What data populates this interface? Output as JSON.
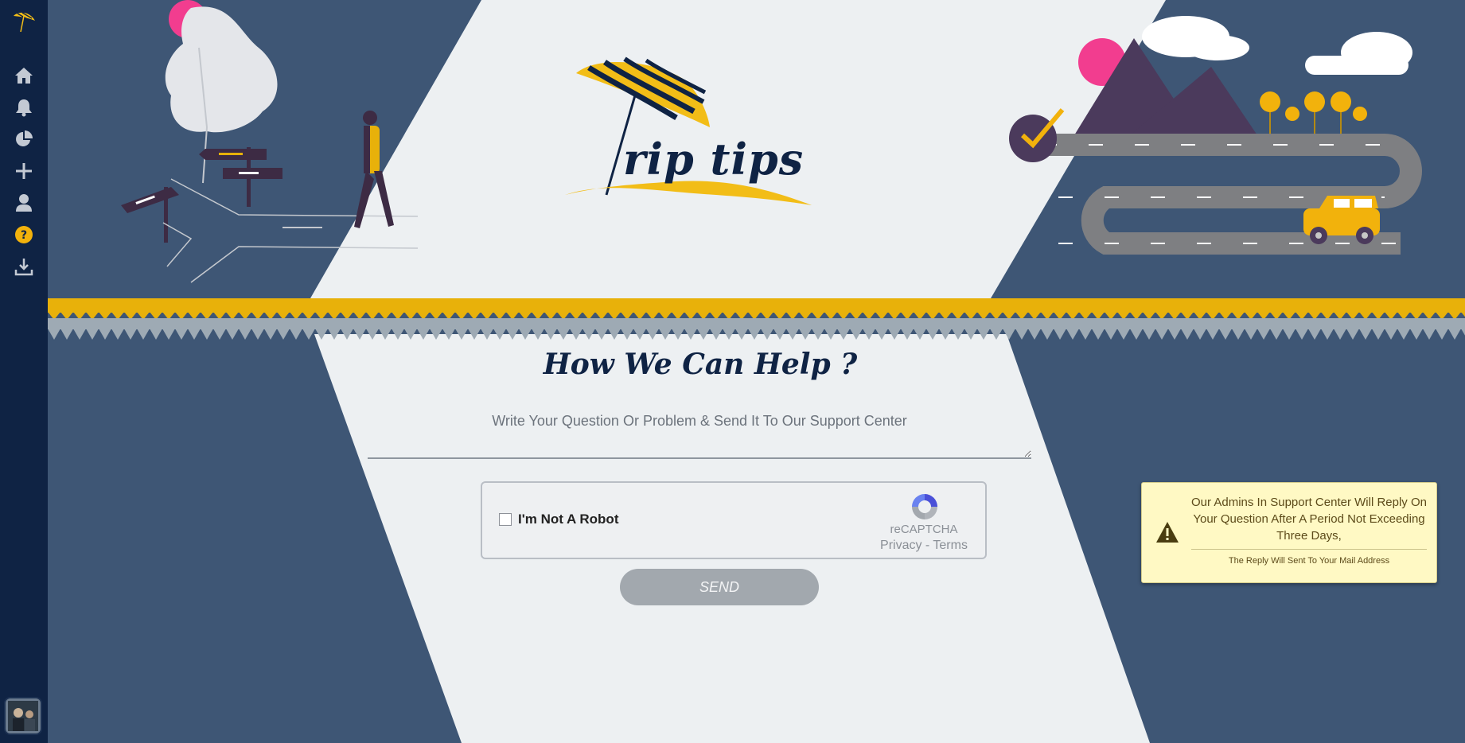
{
  "sidebar": {
    "items": [
      {
        "name": "home-icon",
        "glyph": "home"
      },
      {
        "name": "bell-icon",
        "glyph": "bell"
      },
      {
        "name": "pie-chart-icon",
        "glyph": "pie"
      },
      {
        "name": "plus-icon",
        "glyph": "plus"
      },
      {
        "name": "user-icon",
        "glyph": "user"
      },
      {
        "name": "help-icon",
        "glyph": "help",
        "active": true
      },
      {
        "name": "download-icon",
        "glyph": "download"
      }
    ]
  },
  "brand": {
    "logo_text": "rip tips"
  },
  "help": {
    "title": "How We Can Help ?",
    "placeholder": "Write Your Question Or Problem & Send It To Our Support Center",
    "value": ""
  },
  "captcha": {
    "label": "I'm Not A Robot",
    "brand": "reCAPTCHA",
    "privacy": "Privacy",
    "separator": " - ",
    "terms": "Terms"
  },
  "send_label": "SEND",
  "notice": {
    "message": "Our Admins In Support Center Will Reply On Your Question After A Period Not Exceeding Three Days,",
    "sub": "The Reply Will Sent To Your Mail Address"
  },
  "colors": {
    "navy": "#0f2344",
    "slate": "#3e5675",
    "light": "#edf0f2",
    "yellow": "#e8b10a",
    "pink": "#f23d8f"
  }
}
